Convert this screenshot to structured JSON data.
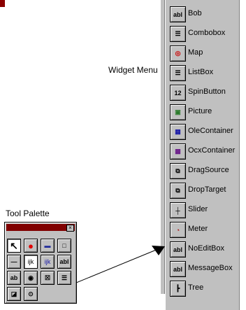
{
  "labels": {
    "widget_menu": "Widget Menu",
    "tool_palette": "Tool Palette"
  },
  "menu_items": [
    {
      "label": "Bob",
      "icon": "textbox-ab-icon",
      "glyph": "abl"
    },
    {
      "label": "Combobox",
      "icon": "combobox-icon",
      "glyph": "☰"
    },
    {
      "label": "Map",
      "icon": "target-icon",
      "glyph": "◎"
    },
    {
      "label": "ListBox",
      "icon": "listbox-icon",
      "glyph": "☰"
    },
    {
      "label": "SpinButton",
      "icon": "spin-icon",
      "glyph": "12"
    },
    {
      "label": "Picture",
      "icon": "picture-icon",
      "glyph": "▣"
    },
    {
      "label": "OleContainer",
      "icon": "ole-icon",
      "glyph": "▦"
    },
    {
      "label": "OcxContainer",
      "icon": "ocx-icon",
      "glyph": "▩"
    },
    {
      "label": "DragSource",
      "icon": "dragsource-icon",
      "glyph": "⧉"
    },
    {
      "label": "DropTarget",
      "icon": "droptarget-icon",
      "glyph": "⧉"
    },
    {
      "label": "Slider",
      "icon": "slider-icon",
      "glyph": "┼"
    },
    {
      "label": "Meter",
      "icon": "meter-icon",
      "glyph": "◔"
    },
    {
      "label": "NoEditBox",
      "icon": "noeditbox-icon",
      "glyph": "abl"
    },
    {
      "label": "MessageBox",
      "icon": "messagebox-icon",
      "glyph": "abl"
    },
    {
      "label": "Tree",
      "icon": "tree-icon",
      "glyph": "┣"
    }
  ],
  "palette_tools": [
    {
      "icon": "pointer-icon",
      "glyph": "↖"
    },
    {
      "icon": "red-ball-icon",
      "glyph": "●"
    },
    {
      "icon": "blue-bar-icon",
      "glyph": "▬"
    },
    {
      "icon": "square-icon",
      "glyph": "□"
    },
    {
      "icon": "line-icon",
      "glyph": "—"
    },
    {
      "icon": "ijk-label-icon",
      "glyph": "ijk"
    },
    {
      "icon": "ijk-blue-icon",
      "glyph": "ijk"
    },
    {
      "icon": "textbox-icon",
      "glyph": "abl"
    },
    {
      "icon": "ab-icon",
      "glyph": "ab"
    },
    {
      "icon": "radio-icon",
      "glyph": "◉"
    },
    {
      "icon": "checkbox-icon",
      "glyph": "☒"
    },
    {
      "icon": "list-icon",
      "glyph": "☰"
    },
    {
      "icon": "eraser-icon",
      "glyph": "◪"
    },
    {
      "icon": "widget-menu-icon",
      "glyph": "⊙"
    }
  ],
  "colors": {
    "titlebar": "#800000",
    "face": "#c0c0c0",
    "red_ball": "#e00000",
    "blue_bar": "#1f2a9a",
    "ijk_blue": "#1a1aa8"
  }
}
